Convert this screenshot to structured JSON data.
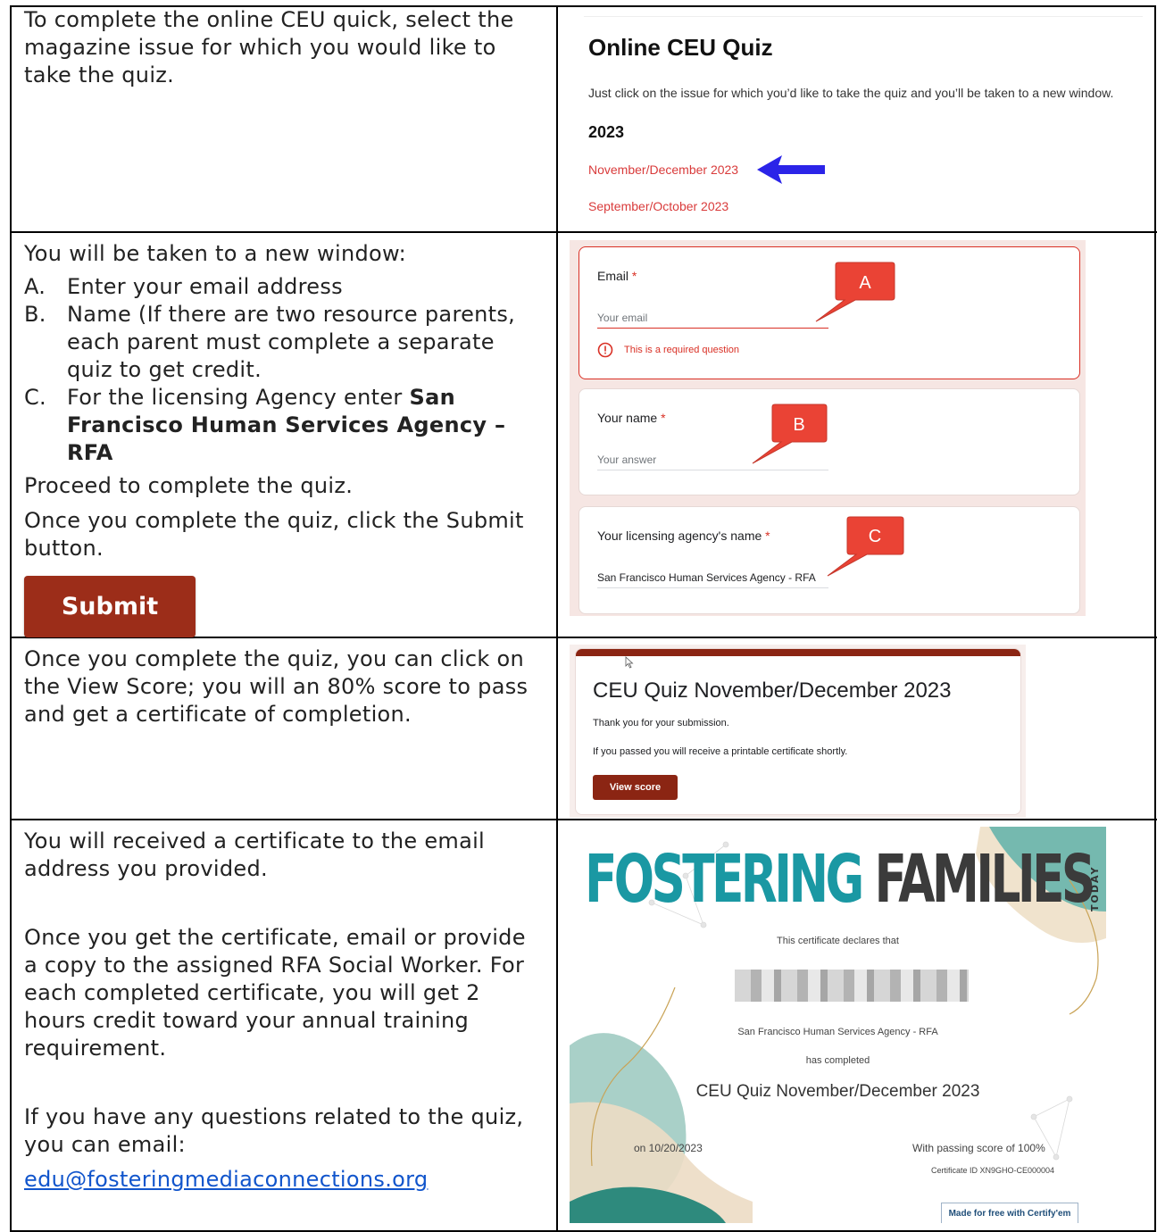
{
  "rows": {
    "r1": {
      "instruction": "To complete the online CEU quick, select the magazine issue for which you would like to take the quiz."
    },
    "r2": {
      "intro": "You will be taken to a new window:",
      "items": [
        {
          "marker": "A.",
          "text": "Enter your email address"
        },
        {
          "marker": "B.",
          "text": "Name (If there are two resource parents, each parent must complete a separate quiz to get credit."
        },
        {
          "marker": "C.",
          "text_before": "For the licensing Agency enter ",
          "text_bold": "San Francisco Human Services Agency – RFA"
        }
      ],
      "proceed": "Proceed to complete the quiz.",
      "once": "Once you complete the quiz, click the Submit button.",
      "submit_label": "Submit"
    },
    "r3": {
      "instruction": "Once you complete the quiz, you can click on the View Score; you will an 80% score to pass and get a certificate of completion."
    },
    "r4": {
      "p1": "You will received a certificate to the email address you provided.",
      "p2": "Once you get the certificate, email or provide a copy to the assigned RFA Social Worker.   For each completed certificate, you will get 2 hours credit toward your annual training requirement.",
      "p3": "If you have any questions related to the quiz, you can email:",
      "email": "edu@fosteringmediaconnections.org"
    }
  },
  "quiz_page": {
    "title": "Online CEU Quiz",
    "description": "Just click on the issue for which you’d like to take the quiz and you’ll be taken to a new window.",
    "year": "2023",
    "issues": [
      "November/December 2023",
      "September/October 2023"
    ]
  },
  "form": {
    "email": {
      "label": "Email",
      "required": "*",
      "placeholder": "Your email",
      "error": "This is a required question",
      "callout": "A"
    },
    "name": {
      "label": "Your name",
      "required": "*",
      "placeholder": "Your answer",
      "callout": "B"
    },
    "agency": {
      "label": "Your licensing agency's name",
      "required": "*",
      "value": "San Francisco Human Services Agency - RFA",
      "callout": "C"
    }
  },
  "confirmation": {
    "title": "CEU Quiz November/December 2023",
    "line1": "Thank you for your submission.",
    "line2": "If you passed you will receive a printable certificate shortly.",
    "button": "View score"
  },
  "certificate": {
    "brand_a": "FOSTERING",
    "brand_b": "FAMILIES",
    "brand_c": "TODAY",
    "declares": "This certificate declares that",
    "agency": "San Francisco Human Services Agency - RFA",
    "completed": "has completed",
    "course": "CEU Quiz November/December 2023",
    "date": "on 10/20/2023",
    "score": "With passing score of 100%",
    "cert_id": "Certificate ID XN9GHO-CE000004",
    "made_free": "Made for free with Certify'em"
  },
  "colors": {
    "link_red": "#d93b3b",
    "button_brown": "#9c2d19",
    "arrow_blue": "#2b24e8",
    "callout_red": "#ea4335",
    "brand_teal": "#1a98a3"
  }
}
